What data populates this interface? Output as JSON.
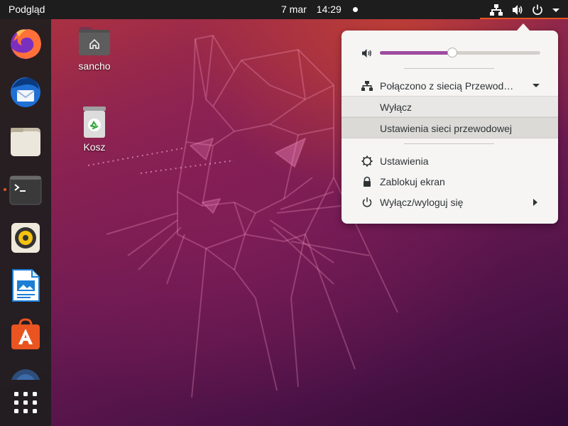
{
  "top_bar": {
    "activities": "Podgląd",
    "date": "7 mar",
    "time": "14:29",
    "tray_icons": [
      "network-wired-icon",
      "volume-icon",
      "power-icon",
      "menu-arrow-down-icon"
    ]
  },
  "dock": {
    "apps": [
      {
        "name": "firefox",
        "icon": "firefox-icon"
      },
      {
        "name": "thunderbird",
        "icon": "thunderbird-icon"
      },
      {
        "name": "files",
        "icon": "files-icon"
      },
      {
        "name": "terminal",
        "icon": "terminal-icon",
        "running": true
      },
      {
        "name": "rhythmbox",
        "icon": "rhythmbox-icon"
      },
      {
        "name": "libreoffice-writer",
        "icon": "writer-icon"
      },
      {
        "name": "ubuntu-software",
        "icon": "software-center-icon"
      },
      {
        "name": "help",
        "icon": "help-icon"
      }
    ],
    "show_apps_icon": "app-grid-icon"
  },
  "desktop": {
    "icons": [
      {
        "label": "sancho",
        "icon": "home-folder-icon"
      },
      {
        "label": "Kosz",
        "icon": "trash-icon"
      }
    ]
  },
  "system_menu": {
    "volume": {
      "icon": "volume-icon",
      "level": 0.45
    },
    "network": {
      "label": "Połączono z siecią Przewod…",
      "icon": "network-wired-icon",
      "expand_icon": "triangle-down-icon"
    },
    "network_submenu": [
      "Wyłącz",
      "Ustawienia sieci przewodowej"
    ],
    "items": [
      {
        "label": "Ustawienia",
        "icon": "settings-icon"
      },
      {
        "label": "Zablokuj ekran",
        "icon": "lock-icon"
      },
      {
        "label": "Wyłącz/wyloguj się",
        "icon": "power-icon",
        "submenu_icon": "triangle-right-icon"
      }
    ]
  },
  "colors": {
    "accent": "#e95420",
    "top_bar": "#1d1d1d",
    "menu_bg": "#f6f5f4",
    "slider_fill": "#9e4b9e",
    "running_indicator": "#e95420"
  }
}
